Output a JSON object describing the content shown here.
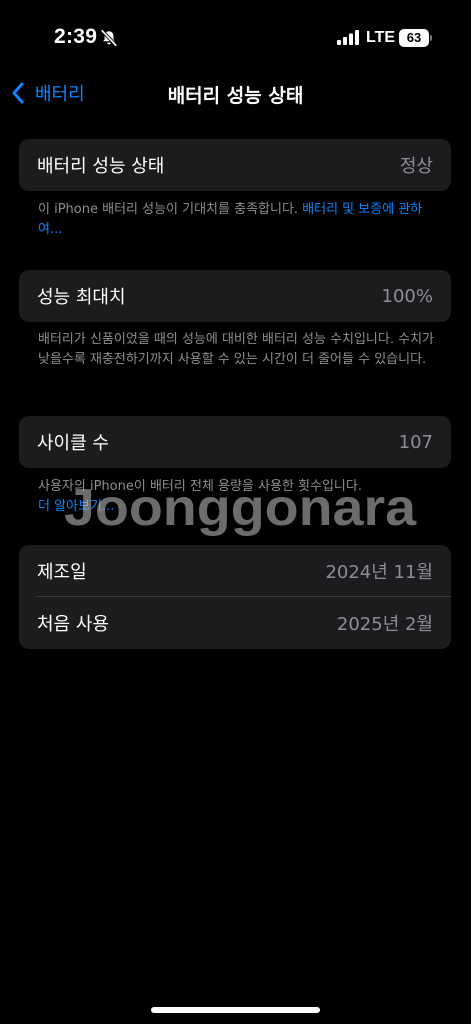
{
  "status_bar": {
    "time": "2:39",
    "network": "LTE",
    "battery_level": "63"
  },
  "nav": {
    "back_label": "배터리",
    "title": "배터리 성능 상태"
  },
  "battery_health": {
    "label": "배터리 성능 상태",
    "value": "정상",
    "footnote_text": "이 iPhone 배터리 성능이 기대치를 충족합니다. ",
    "footnote_link": "배터리 및 보증에 관하여..."
  },
  "maximum_capacity": {
    "label": "성능 최대치",
    "value": "100%",
    "footnote": "배터리가 신품이었을 때의 성능에 대비한 배터리 성능 수치입니다. 수치가 낮을수록 재충전하기까지 사용할 수 있는 시간이 더 줄어들 수 있습니다."
  },
  "cycle_count": {
    "label": "사이클 수",
    "value": "107",
    "footnote_text": "사용자의 iPhone이 배터리 전체 용량을 사용한 횟수입니다.",
    "footnote_link": "더 알아보기..."
  },
  "dates": {
    "manufacture_label": "제조일",
    "manufacture_value": "2024년 11월",
    "first_use_label": "처음 사용",
    "first_use_value": "2025년 2월"
  },
  "watermark": {
    "text": "Joonggonara"
  },
  "colors": {
    "accent": "#0a84ff",
    "background": "#000000",
    "cell": "#1c1c1e",
    "secondary_text": "#8e8e93"
  },
  "icons": [
    "bell-slash-icon",
    "cellular-signal-icon",
    "battery-icon",
    "chevron-left-icon"
  ]
}
